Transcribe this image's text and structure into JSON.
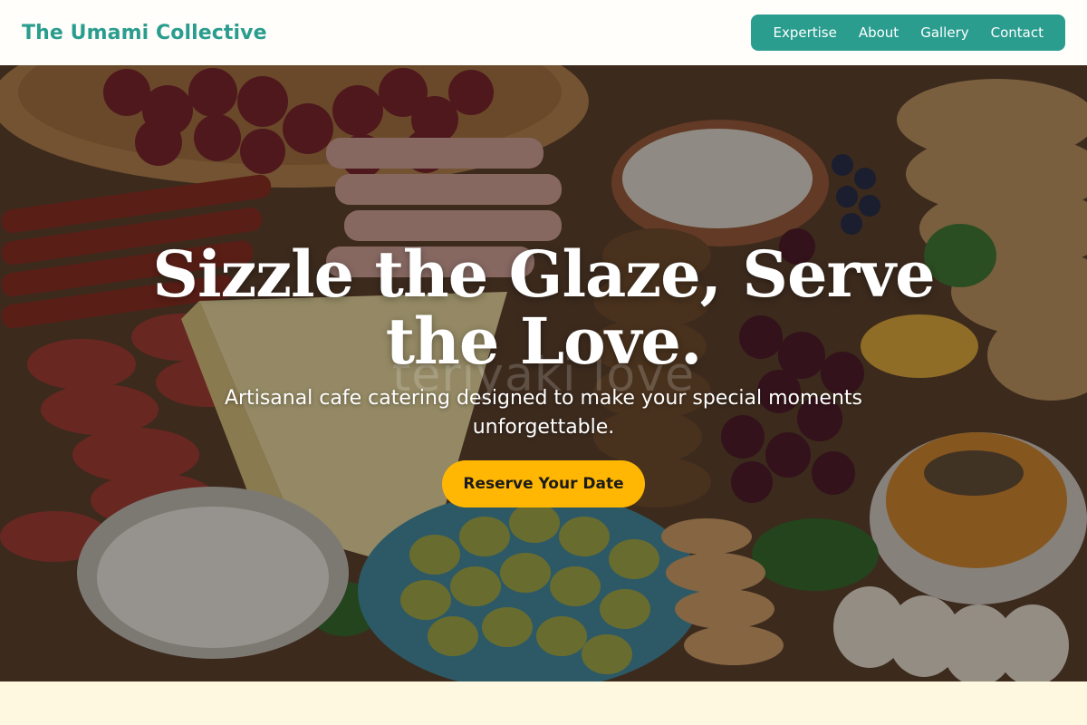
{
  "header": {
    "brand": "The Umami Collective",
    "nav": [
      {
        "label": "Expertise"
      },
      {
        "label": "About"
      },
      {
        "label": "Gallery"
      },
      {
        "label": "Contact"
      }
    ]
  },
  "hero": {
    "title": "Sizzle the Glaze, Serve the Love.",
    "subtitle": "Artisanal cafe catering designed to make your special moments unforgettable.",
    "watermark": "teriyaki love",
    "cta_label": "Reserve Your Date",
    "background_image": "charcuterie-board-photo"
  },
  "colors": {
    "brand": "#2a9d8f",
    "cta": "#ffb703",
    "page_background": "#fff8e1"
  }
}
